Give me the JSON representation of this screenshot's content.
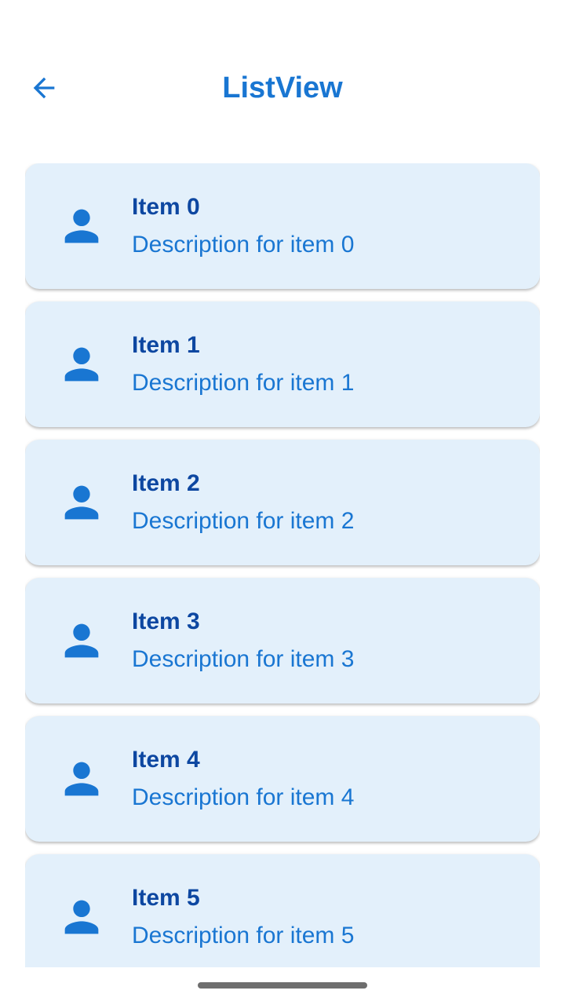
{
  "app_bar": {
    "title": "ListView",
    "back_icon": "arrow-back-icon"
  },
  "colors": {
    "primary": "#1976d2",
    "title_text": "#0d47a1",
    "card_background": "#e3f0fb"
  },
  "items": [
    {
      "title": "Item 0",
      "description": "Description for item 0",
      "icon": "person-icon"
    },
    {
      "title": "Item 1",
      "description": "Description for item 1",
      "icon": "person-icon"
    },
    {
      "title": "Item 2",
      "description": "Description for item 2",
      "icon": "person-icon"
    },
    {
      "title": "Item 3",
      "description": "Description for item 3",
      "icon": "person-icon"
    },
    {
      "title": "Item 4",
      "description": "Description for item 4",
      "icon": "person-icon"
    },
    {
      "title": "Item 5",
      "description": "Description for item 5",
      "icon": "person-icon"
    }
  ]
}
